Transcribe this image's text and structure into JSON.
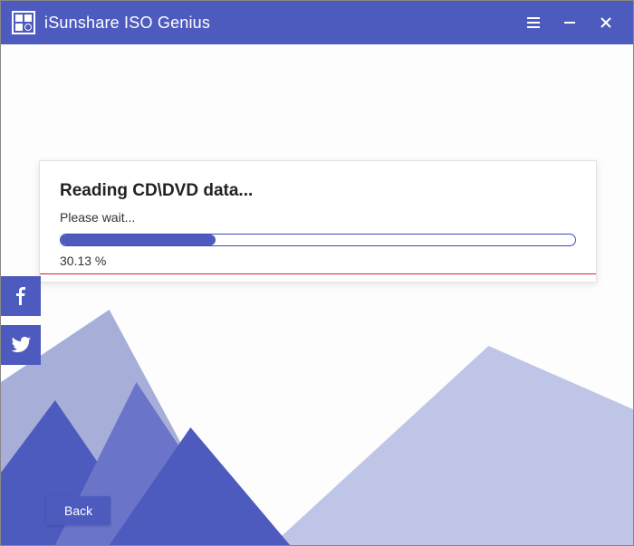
{
  "titlebar": {
    "app_title": "iSunshare ISO Genius"
  },
  "card": {
    "heading": "Reading CD\\DVD data...",
    "wait_text": "Please wait...",
    "percent_value": 30.13,
    "percent_text": "30.13 %"
  },
  "buttons": {
    "back_label": "Back"
  },
  "colors": {
    "brand": "#4e5bbe"
  }
}
